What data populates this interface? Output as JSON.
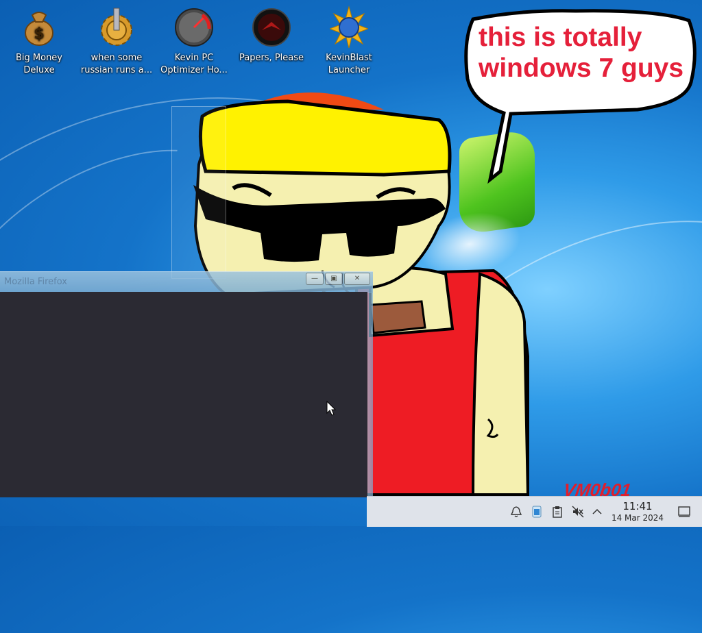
{
  "desktop_icons": [
    {
      "label": "Big Money\nDeluxe",
      "icon": "money-bag-icon"
    },
    {
      "label": "when some\nrussian runs a...",
      "icon": "gear-icon"
    },
    {
      "label": "Kevin PC\nOptimizer Ho...",
      "icon": "speedometer-icon"
    },
    {
      "label": "Papers, Please",
      "icon": "papers-please-icon"
    },
    {
      "label": "KevinBlast\nLauncher",
      "icon": "starburst-globe-icon"
    }
  ],
  "speech_bubble": "this is totally\nwindows 7 guys",
  "signature": "VM0b01",
  "window": {
    "title": "Mozilla Firefox",
    "minimize": "—",
    "maximize": "▣",
    "close": "✕"
  },
  "taskbar": {
    "time": "11:41",
    "date": "14 Mar 2024",
    "tray_icons": [
      "notifications-icon",
      "network-icon",
      "clipboard-icon",
      "volume-muted-icon",
      "show-hidden-icon",
      "show-desktop-icon"
    ]
  },
  "colors": {
    "bubble_text": "#e5203a",
    "window_body": "#2b2a33",
    "taskbar": "#dfe3ea"
  }
}
